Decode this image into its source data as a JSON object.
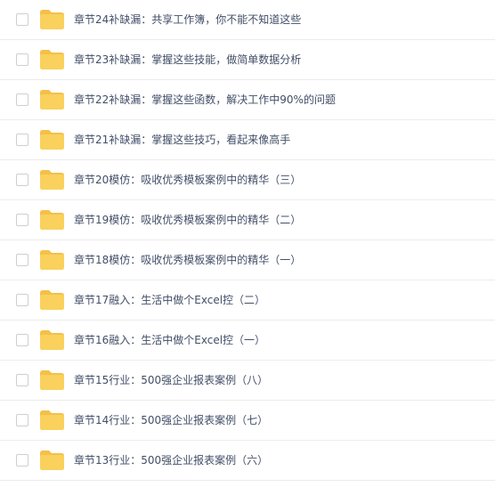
{
  "files": [
    {
      "name": "章节24补缺漏：共享工作簿，你不能不知道这些",
      "icon": "folder-icon"
    },
    {
      "name": "章节23补缺漏：掌握这些技能，做简单数据分析",
      "icon": "folder-icon"
    },
    {
      "name": "章节22补缺漏：掌握这些函数，解决工作中90%的问题",
      "icon": "folder-icon"
    },
    {
      "name": "章节21补缺漏：掌握这些技巧，看起来像高手",
      "icon": "folder-icon"
    },
    {
      "name": "章节20模仿：吸收优秀模板案例中的精华（三）",
      "icon": "folder-icon"
    },
    {
      "name": "章节19模仿：吸收优秀模板案例中的精华（二）",
      "icon": "folder-icon"
    },
    {
      "name": "章节18模仿：吸收优秀模板案例中的精华（一）",
      "icon": "folder-icon"
    },
    {
      "name": "章节17融入：生活中做个Excel控（二）",
      "icon": "folder-icon"
    },
    {
      "name": "章节16融入：生活中做个Excel控（一）",
      "icon": "folder-icon"
    },
    {
      "name": "章节15行业：500强企业报表案例（八）",
      "icon": "folder-icon"
    },
    {
      "name": "章节14行业：500强企业报表案例（七）",
      "icon": "folder-icon"
    },
    {
      "name": "章节13行业：500强企业报表案例（六）",
      "icon": "folder-icon"
    }
  ],
  "colors": {
    "folder_body": "#f9d15c",
    "folder_tab": "#f4c04a",
    "text": "#424e67",
    "divider": "#ececec"
  }
}
